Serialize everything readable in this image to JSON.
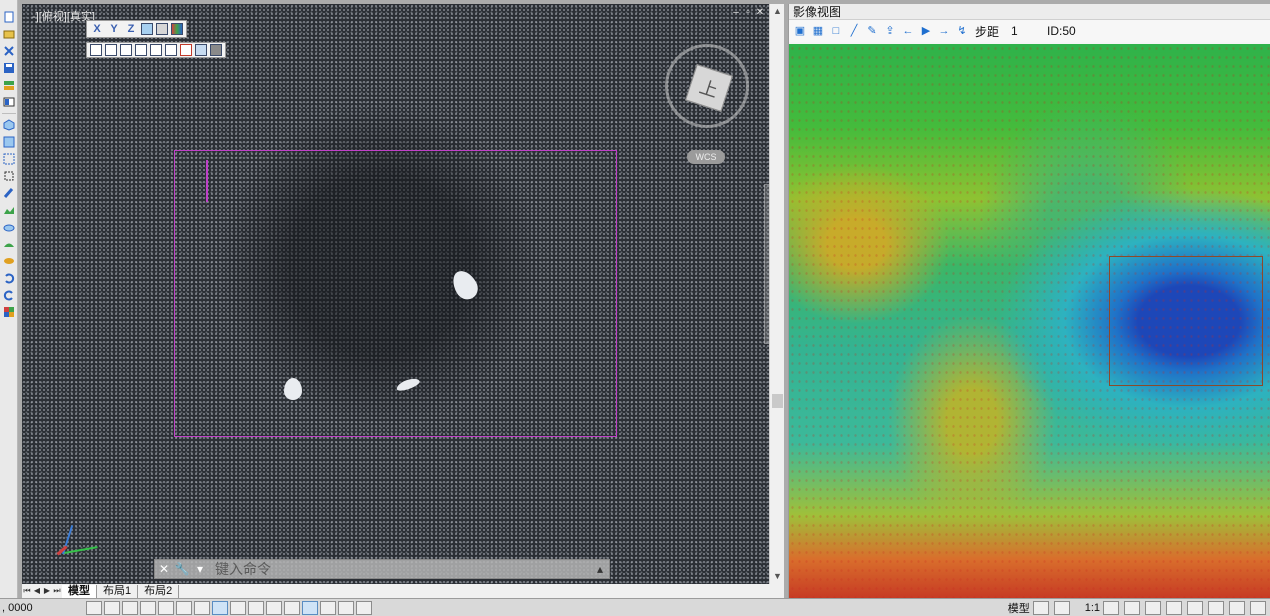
{
  "app": {
    "viewport_label": "-][俯视][真实]"
  },
  "viewport": {
    "viewcube_face": "上",
    "wcs_label": "WCS"
  },
  "float_toolbar_1": [
    "X",
    "Y",
    "Z"
  ],
  "command": {
    "placeholder": "键入命令"
  },
  "layout_tabs": [
    "模型",
    "布局1",
    "布局2"
  ],
  "image_panel": {
    "title": "影像视图",
    "step_label": "步距",
    "step_value": "1",
    "id_label": "ID:50"
  },
  "status": {
    "coord": ", 0000",
    "model_label": "模型",
    "scale_label": "1:1"
  },
  "colors": {
    "accent": "#c040c8",
    "highlight_box": "#8b4a2a"
  }
}
